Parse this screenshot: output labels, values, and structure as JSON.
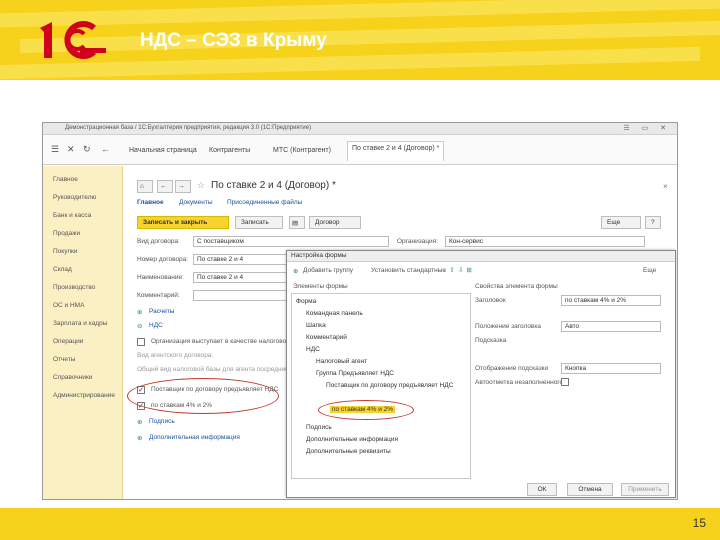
{
  "slide": {
    "title": "НДС – СЭЗ в Крыму",
    "page_number": "15",
    "logo_text": "1С"
  },
  "window": {
    "title": "Демонстрационная база / 1С:Бухгалтерия предприятия, редакция 3.0 (1С:Предприятие)"
  },
  "tabs": [
    {
      "label": "Начальная страница"
    },
    {
      "label": "Контрагенты"
    },
    {
      "label": "МТС (Контрагент)"
    },
    {
      "label": "По ставке 2 и 4 (Договор) *"
    }
  ],
  "sidebar": {
    "items": [
      "Главное",
      "Руководителю",
      "Банк и касса",
      "Продажи",
      "Покупки",
      "Склад",
      "Производство",
      "ОС и НМА",
      "Зарплата и кадры",
      "Операции",
      "Отчеты",
      "Справочники",
      "Администрирование"
    ]
  },
  "doc": {
    "title": "По ставке 2 и 4 (Договор) *",
    "subtabs": [
      "Главное",
      "Документы",
      "Присоединенные файлы"
    ],
    "buttons": {
      "save_close": "Записать и закрыть",
      "save": "Записать",
      "contract": "Договор",
      "more": "Еще",
      "help": "?"
    },
    "fields": [
      {
        "label": "Вид договора:",
        "value": "С поставщиком"
      },
      {
        "label": "Номер договора:",
        "value": "По ставке 2 и 4"
      },
      {
        "label": "Наименование:",
        "value": "По ставке 2 и 4"
      },
      {
        "label": "Комментарий:",
        "value": ""
      }
    ],
    "org_label": "Организация:",
    "org_value": "Кон-сервис",
    "links": {
      "prices": "Расчеты",
      "vat": "НДС",
      "print": "Подпись",
      "extra": "Дополнительная информация"
    },
    "agent_label": "Организация выступает в качестве налогового агента",
    "vat_type_label": "Вид агентского договора:",
    "base_note": "Общий вид налоговой базы для агента посредника",
    "supplier_vat_label": "Поставщик по договору предъявляет НДС",
    "rate_label": "по ставкам 4% и 2%"
  },
  "dialog": {
    "title": "Настройка формы",
    "toolbar": {
      "add_group": "Добавить группу",
      "restore": "Установить стандартные",
      "more": "Еще"
    },
    "left_header": "Элементы формы",
    "right_header": "Свойства элемента формы",
    "tree": [
      "Форма",
      "Командная панель",
      "Шапка",
      "Комментарий",
      "НДС",
      "Налоговый агент",
      "Группа Предъявляет НДС",
      "Поставщик по договору предъявляет НДС",
      "по ставкам 4% и 2%",
      "Подпись",
      "Дополнительные информация",
      "Дополнительные реквизиты"
    ],
    "props": [
      {
        "label": "Заголовок",
        "value": "по ставкам 4% и 2%"
      },
      {
        "label": "Положение заголовка",
        "value": "Авто"
      },
      {
        "label": "Подсказка",
        "value": ""
      },
      {
        "label": "Отображение подсказки",
        "value": "Кнопка"
      },
      {
        "label": "Автоотметка незаполненного",
        "value": ""
      }
    ],
    "buttons": {
      "ok": "ОК",
      "cancel": "Отмена",
      "apply": "Применить"
    }
  }
}
